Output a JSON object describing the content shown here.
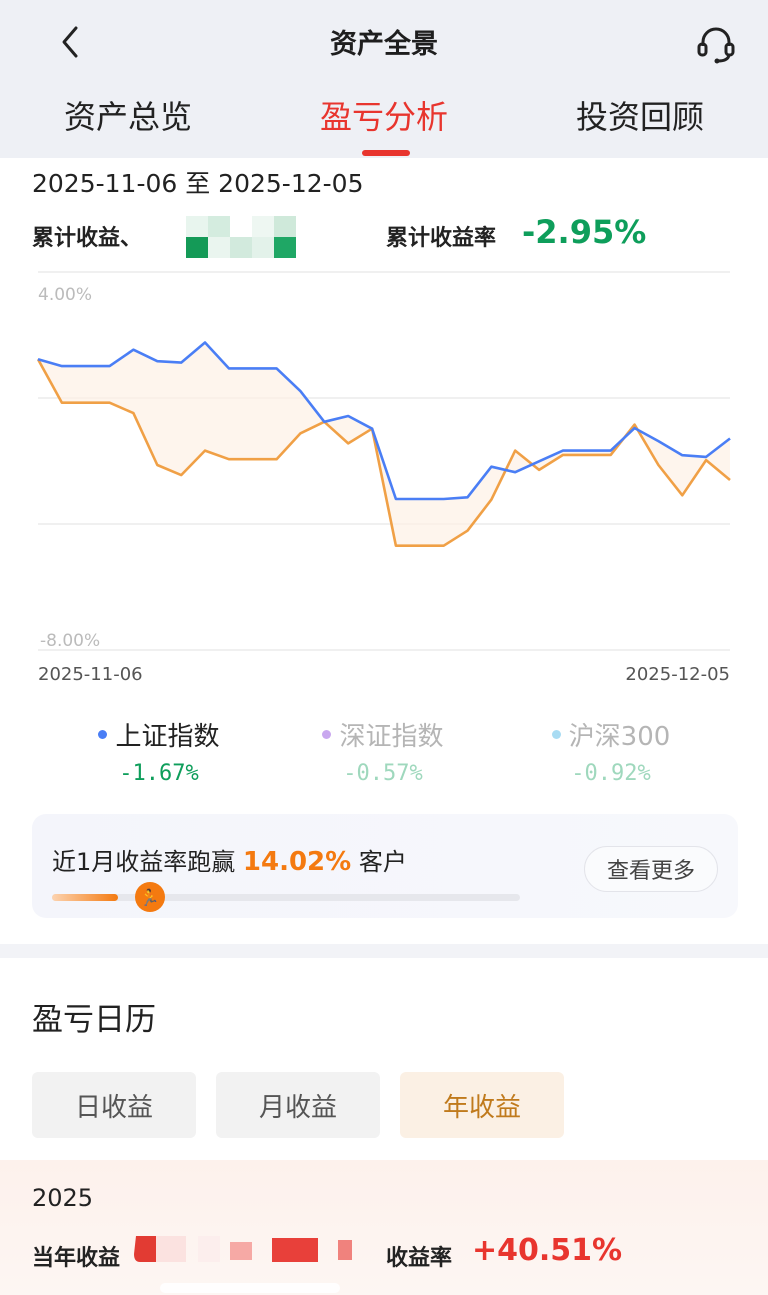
{
  "header": {
    "title": "资产全景",
    "tabs": [
      {
        "label": "资产总览",
        "active": false
      },
      {
        "label": "盈亏分析",
        "active": true
      },
      {
        "label": "投资回顾",
        "active": false
      }
    ]
  },
  "summary": {
    "date_range": "2025-11-06 至 2025-12-05",
    "cum_label": "累计收益、",
    "rate_label": "累计收益率",
    "rate_value": "-2.95%",
    "negative_color": "#0e9e5b",
    "positive_color": "#e8352e"
  },
  "chart_data": {
    "type": "line",
    "y_top_label": "4.00%",
    "y_bottom_label": "-8.00%",
    "x_start_label": "2025-11-06",
    "x_end_label": "2025-12-05",
    "ylim": [
      -8,
      4
    ],
    "grid": true,
    "series": [
      {
        "name": "上证指数",
        "color": "#4a7ef5",
        "values": [
          1.67,
          1.43,
          1.43,
          1.43,
          2.0,
          1.6,
          1.55,
          2.25,
          1.35,
          1.35,
          1.35,
          0.56,
          -0.5,
          -0.3,
          -0.74,
          -3.18,
          -3.18,
          -3.18,
          -3.12,
          -2.06,
          -2.25,
          -1.87,
          -1.5,
          -1.5,
          -1.5,
          -0.72,
          -1.17,
          -1.66,
          -1.72,
          -1.08
        ]
      },
      {
        "color": "#f0a046",
        "values": [
          1.67,
          0.16,
          0.16,
          0.16,
          -0.2,
          -2.0,
          -2.35,
          -1.5,
          -1.8,
          -1.8,
          -1.8,
          -0.9,
          -0.5,
          -1.25,
          -0.74,
          -4.8,
          -4.8,
          -4.8,
          -4.28,
          -3.2,
          -1.5,
          -2.17,
          -1.65,
          -1.65,
          -1.65,
          -0.6,
          -2.0,
          -3.05,
          -1.83,
          -2.52
        ]
      }
    ]
  },
  "legend": [
    {
      "name": "上证指数",
      "value": "-1.67%",
      "dot": "#4a7ef5",
      "name_color": "#222222",
      "value_color": "#0e9e5b"
    },
    {
      "name": "深证指数",
      "value": "-0.57%",
      "dot": "#c9a8ef",
      "name_color": "#b5b5b5",
      "value_color": "#9fd8bd"
    },
    {
      "name": "沪深300",
      "value": "-0.92%",
      "dot": "#a9dcf3",
      "name_color": "#b5b5b5",
      "value_color": "#9fd8bd"
    }
  ],
  "beat": {
    "text_pre": "近1月收益率跑赢 ",
    "pct": "14.02%",
    "text_post": " 客户",
    "progress_fraction": 0.1402,
    "button": "查看更多"
  },
  "calendar": {
    "title": "盈亏日历",
    "segments": [
      {
        "label": "日收益",
        "active": false
      },
      {
        "label": "月收益",
        "active": false
      },
      {
        "label": "年收益",
        "active": true
      }
    ],
    "year": "2025",
    "year_income_label": "当年收益",
    "year_rate_label": "收益率",
    "year_rate_value": "+40.51%"
  },
  "icons": {
    "back": "chevron-left-icon",
    "support": "headset-icon",
    "runner": "running-person-icon"
  }
}
